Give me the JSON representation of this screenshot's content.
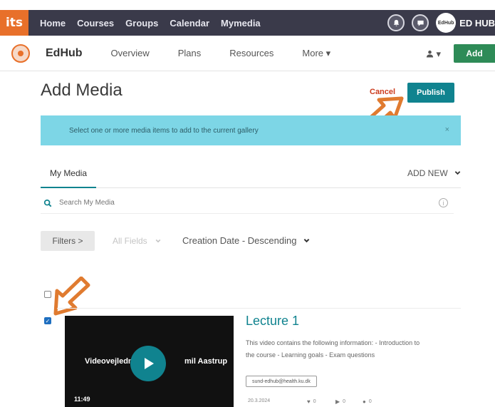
{
  "topnav": {
    "logo": "its",
    "items": [
      "Home",
      "Courses",
      "Groups",
      "Calendar",
      "Mymedia"
    ],
    "badge": "EdHub",
    "user_name": "ED HUB"
  },
  "subnav": {
    "course_title": "EdHub",
    "links": [
      "Overview",
      "Plans",
      "Resources",
      "More ▾"
    ],
    "user_menu": "▾",
    "add_label": "Add"
  },
  "page": {
    "title": "Add Media",
    "cancel_label": "Cancel",
    "publish_label": "Publish",
    "alert_text": "Select one or more media items to add to the current gallery",
    "alert_close": "×"
  },
  "tabs": {
    "my_media": "My Media",
    "add_new": "ADD NEW"
  },
  "search": {
    "placeholder": "Search My Media"
  },
  "filters": {
    "filters_label": "Filters >",
    "all_fields": "All Fields",
    "sort": "Creation Date - Descending"
  },
  "media_item": {
    "thumb_title_left": "Videovejledn",
    "thumb_title_right": "mil Aastrup",
    "duration": "11:49",
    "title": "Lecture 1",
    "description": "This video contains the following information: - Introduction to the course - Learning goals - Exam questions",
    "owner_tag": "sund-edhub@health.ku.dk",
    "date": "20.3.2024",
    "likes": "0",
    "plays": "0",
    "comments": "0",
    "checked": true
  },
  "colors": {
    "accent": "#10838f",
    "arrow": "#e07b30",
    "topnav_bg": "#3a3a4a",
    "add_green": "#2e8b57"
  }
}
